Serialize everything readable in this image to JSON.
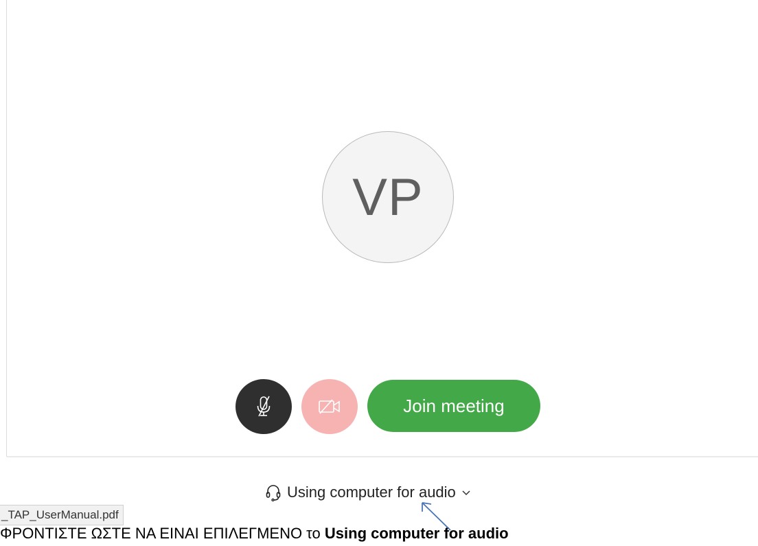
{
  "avatar": {
    "initials": "VP"
  },
  "controls": {
    "mute_icon": "microphone-muted-icon",
    "video_icon": "video-off-icon",
    "join_label": "Join meeting"
  },
  "audio": {
    "icon": "headset-icon",
    "label": "Using computer for audio",
    "chevron": "chevron-down-icon"
  },
  "file_tab": {
    "label": "_TAP_UserManual.pdf"
  },
  "instruction": {
    "prefix": "ΦΡΟΝΤΙΣΤΕ ΩΣΤΕ ΝΑ ΕΙΝΑΙ ΕΠΙΛΕΓΜΕΝΟ το ",
    "emphasis": "Using computer for audio"
  },
  "colors": {
    "join_green": "#43a847",
    "mute_dark": "#2f2f2f",
    "video_pink": "#f7b2b2",
    "arrow_blue": "#4a74b5"
  }
}
